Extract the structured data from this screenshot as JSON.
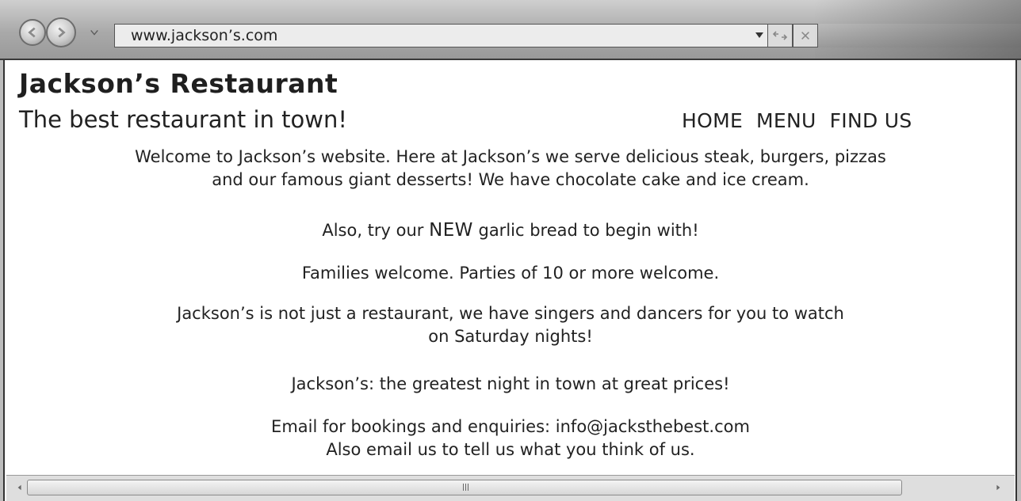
{
  "browser": {
    "url": "www.jackson’s.com",
    "icons": {
      "back": "back-arrow-icon",
      "forward": "forward-arrow-icon",
      "history": "chevron-down-icon",
      "address_dropdown": "dropdown-triangle-icon",
      "refresh": "refresh-icon",
      "stop": "stop-x-icon"
    }
  },
  "site": {
    "title": "Jackson’s Restaurant",
    "tagline": "The best restaurant in town!",
    "nav": [
      "HOME",
      "MENU",
      "FIND US"
    ]
  },
  "body": {
    "p1_line1": "Welcome to Jackson’s website. Here at Jackson’s we serve delicious steak, burgers, pizzas",
    "p1_line2": "and our famous giant desserts! We have chocolate cake and ice cream.",
    "p2_before": "Also, try our ",
    "p2_emphasis": "NEW",
    "p2_after": " garlic bread to begin with!",
    "p3": "Families welcome. Parties of 10 or more welcome.",
    "p4_line1": "Jackson’s is not just a restaurant, we have singers and dancers for you to watch",
    "p4_line2": "on Saturday nights!",
    "p5": "Jackson’s: the greatest night in town at great prices!",
    "p6_line1": "Email for bookings and enquiries: info@jacksthebest.com",
    "p6_line2": "Also email us to tell us what you think of us."
  }
}
